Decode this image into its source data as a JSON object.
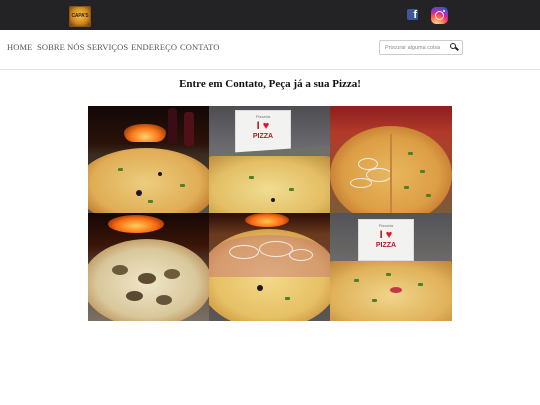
{
  "header": {
    "logo_text": "CAPA'S",
    "social": [
      {
        "name": "facebook",
        "glyph": "f"
      },
      {
        "name": "instagram"
      }
    ]
  },
  "nav": {
    "items": [
      {
        "label": "HOME"
      },
      {
        "label": "SOBRE NÓS"
      },
      {
        "label": "SERVIÇOS"
      },
      {
        "label": "ENDEREÇO"
      },
      {
        "label": "CONTATO"
      }
    ]
  },
  "search": {
    "placeholder": "Procurar alguma coisa",
    "icon": "search-icon"
  },
  "main": {
    "heading": "Entre em Contato, Peça já a sua Pizza!"
  },
  "collage": {
    "signs": [
      {
        "small": "Pizzaria",
        "love": "I",
        "word": "PIZZA"
      },
      {
        "small": "Pizzaria",
        "love": "I",
        "word": "PIZZA"
      }
    ]
  },
  "colors": {
    "topbar": "#232326",
    "facebook": "#3b5998",
    "heading": "#111111"
  }
}
